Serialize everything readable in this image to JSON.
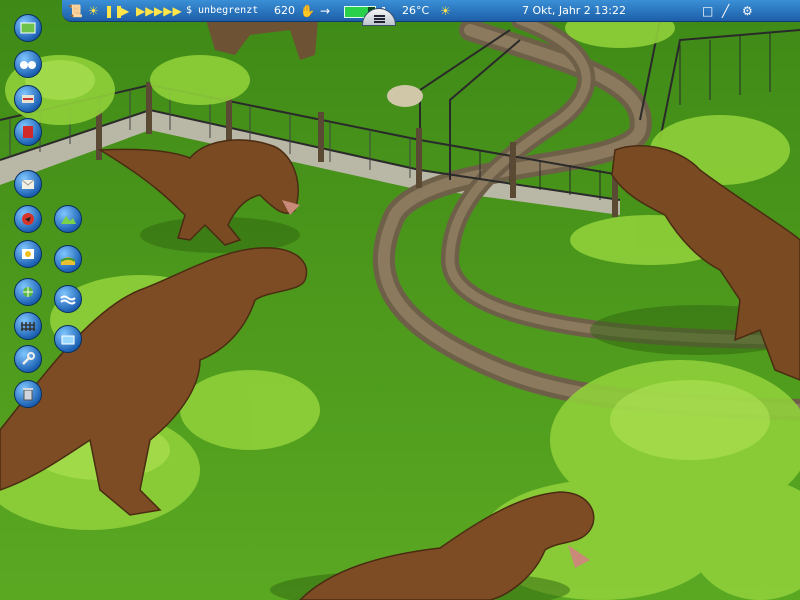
{
  "status_bar": {
    "money": "$ unbegrenzt",
    "rating": "620",
    "health_fraction": 0.75,
    "temperature": "26°C",
    "date_time": "7 Okt, Jahr 2  13:22"
  },
  "icons": {
    "left_toolbar": [
      "map-icon",
      "binoculars-icon",
      "fossil-dig-icon",
      "red-book-icon",
      "mail-icon",
      "dinosaur-icon",
      "egg-icon",
      "terrain-icon",
      "hills-icon",
      "grass-icon",
      "fence-icon",
      "water-icon",
      "path-icon",
      "aquarium-icon",
      "wrench-icon",
      "trash-icon"
    ],
    "top_bar": [
      "scroll-icon",
      "sun-gear-icon",
      "pause-icon",
      "play-icon",
      "fast-forward-icon",
      "fastest-icon",
      "hand-icon",
      "sun-icon",
      "signal-icon",
      "wand-icon",
      "gear-icon"
    ]
  },
  "colors": {
    "bar_blue": "#1d5fa8",
    "grass": "#4f9a1c",
    "path": "#7a6a52",
    "dino": "#7a4a22",
    "fern": "#8fd03a"
  }
}
